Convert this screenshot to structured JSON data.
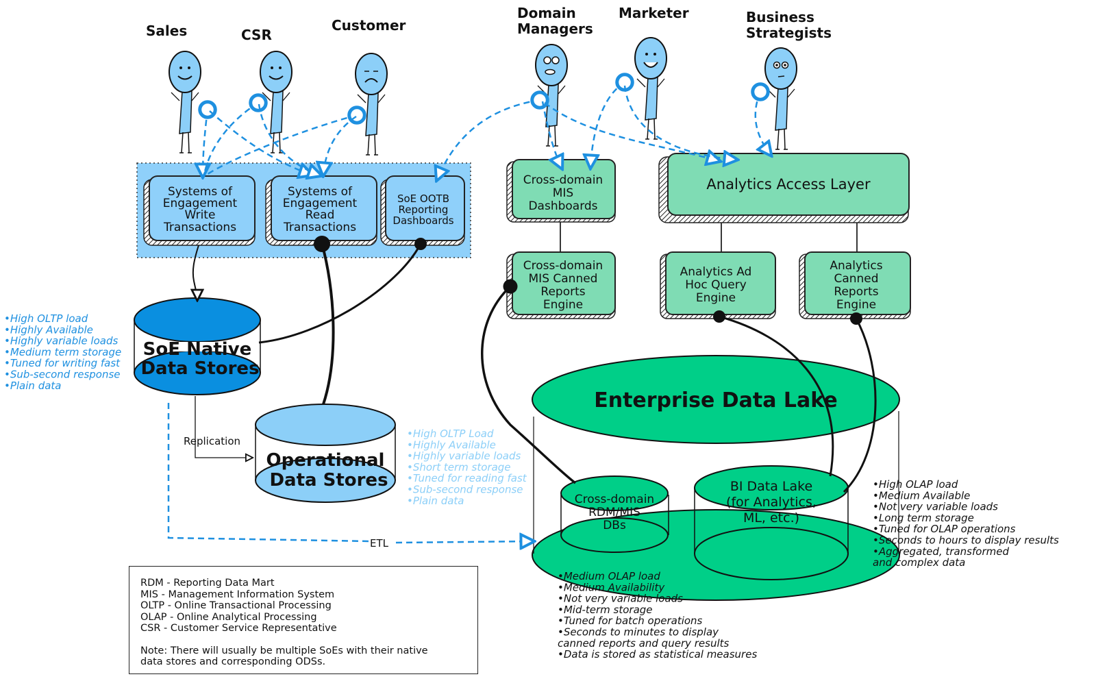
{
  "personas": [
    {
      "label": "Sales",
      "mood": "happy"
    },
    {
      "label": "CSR",
      "mood": "happy"
    },
    {
      "label": "Customer",
      "mood": "sad"
    },
    {
      "label_lines": [
        "Domain",
        "Managers"
      ],
      "mood": "worried"
    },
    {
      "label": "Marketer",
      "mood": "excited"
    },
    {
      "label_lines": [
        "Business",
        "Strategists"
      ],
      "mood": "puzzled"
    }
  ],
  "soe_group": {
    "boxes": [
      {
        "lines": [
          "Systems of",
          "Engagement",
          "Write",
          "Transactions"
        ]
      },
      {
        "lines": [
          "Systems of",
          "Engagement",
          "Read",
          "Transactions"
        ]
      },
      {
        "lines": [
          "SoE OOTB",
          "Reporting",
          "Dashboards"
        ]
      }
    ]
  },
  "analytics_boxes": {
    "mis_dashboards": [
      "Cross-domain",
      "MIS",
      "Dashboards"
    ],
    "access_layer": "Analytics Access Layer",
    "mis_canned": [
      "Cross-domain",
      "MIS Canned",
      "Reports",
      "Engine"
    ],
    "adhoc": [
      "Analytics Ad",
      "Hoc Query",
      "Engine"
    ],
    "analytics_canned": [
      "Analytics",
      "Canned",
      "Reports",
      "Engine"
    ]
  },
  "soe_native": {
    "lines": [
      "SoE Native",
      "Data Stores"
    ],
    "notes": [
      "High OLTP load",
      "Highly Available",
      "Highly variable loads",
      "Medium term storage",
      "Tuned for writing fast",
      "Sub-second response",
      "Plain data"
    ]
  },
  "ods": {
    "lines": [
      "Operational",
      "Data Stores"
    ],
    "notes": [
      "High OLTP Load",
      "Highly Available",
      "Highly variable loads",
      "Short term storage",
      "Tuned for reading fast",
      "Sub-second response",
      "Plain data"
    ]
  },
  "edl": {
    "title": "Enterprise Data Lake",
    "rdm": [
      "Cross-domain",
      "RDM/MIS",
      "DBs"
    ],
    "bi": [
      "BI Data Lake",
      "(for Analytics,",
      "ML, etc.)"
    ],
    "rdm_notes": [
      "Medium OLAP load",
      "Medium Availability",
      "Not very variable loads",
      " Mid-term storage",
      "Tuned for batch operations",
      "Seconds to minutes to display",
      "  canned reports and query results",
      "Data is stored as statistical measures"
    ],
    "bi_notes": [
      "High OLAP load",
      "Medium Available",
      "Not very variable loads",
      "Long term storage",
      "Tuned for OLAP operations",
      "Seconds to hours to display results",
      "Aggregated, transformed",
      "  and complex data"
    ]
  },
  "flows": {
    "replication": "Replication",
    "etl": "ETL"
  },
  "legend": {
    "items": [
      "RDM - Reporting Data Mart",
      "MIS - Management Information System",
      "OLTP - Online Transactional Processing",
      "OLAP - Online Analytical Processing",
      "CSR - Customer Service Representative"
    ],
    "note_lines": [
      "Note: There will usually be multiple SoEs with their native",
      "data stores and corresponding ODSs."
    ]
  },
  "colors": {
    "person": "#8ccff8",
    "soe_group_bg": "#8fd0fa",
    "analytics_box": "#7fdcb4",
    "edl": "#00cf88",
    "soe_native_cyl": "#0a8fe0",
    "ods_cyl": "#8ccff8",
    "dashed_flow": "#1e90e0"
  }
}
